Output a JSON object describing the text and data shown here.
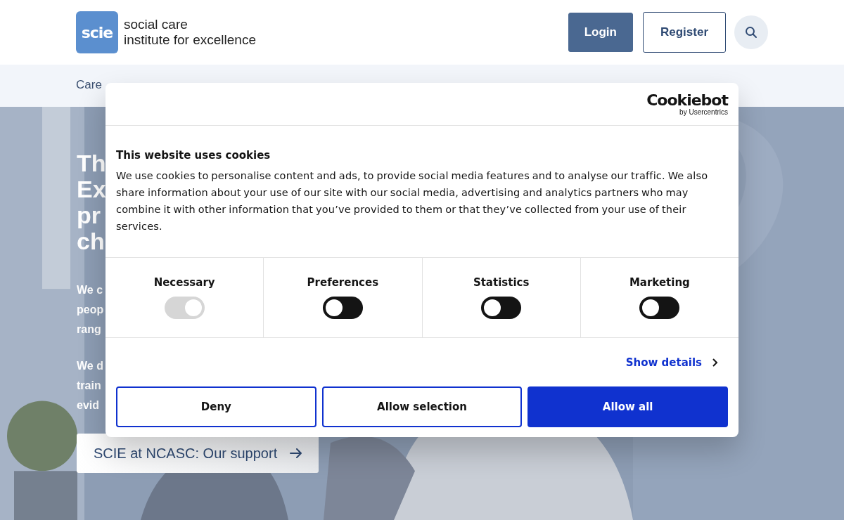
{
  "header": {
    "logo_mark": "scie",
    "logo_text": [
      "social care",
      "institute for excellence"
    ],
    "buttons": [
      {
        "label": "Login",
        "kind": "primary"
      },
      {
        "label": "Register",
        "kind": "outline"
      }
    ]
  },
  "nav": {
    "items": [
      "Care"
    ]
  },
  "hero": {
    "kind": "picture",
    "heading_lines": [
      "Th",
      "Ex",
      "pr",
      "ch"
    ],
    "paragraphs": [
      [
        "We c",
        "peop",
        "rang"
      ],
      [
        "We d",
        "train",
        "evid"
      ]
    ],
    "cta": "SCIE at NCASC: Our support"
  },
  "cookie_dialog": {
    "brand": "Cookiebot",
    "brand_sub": "by Usercentrics",
    "title": "This website uses cookies",
    "text": "We use cookies to personalise content and ads, to provide social media features and to analyse our traffic. We also share information about your use of our site with our social media, advertising and analytics partners who may combine it with other information that you’ve provided to them or that they’ve collected from your use of their services.",
    "categories": [
      {
        "label": "Necessary",
        "checked": true,
        "disabled": true
      },
      {
        "label": "Preferences",
        "checked": false,
        "disabled": false
      },
      {
        "label": "Statistics",
        "checked": false,
        "disabled": false
      },
      {
        "label": "Marketing",
        "checked": false,
        "disabled": false
      }
    ],
    "details_link": "Show details",
    "buttons": [
      {
        "label": "Deny",
        "kind": "outline"
      },
      {
        "label": "Allow selection",
        "kind": "outline"
      },
      {
        "label": "Allow all",
        "kind": "primary"
      }
    ]
  }
}
